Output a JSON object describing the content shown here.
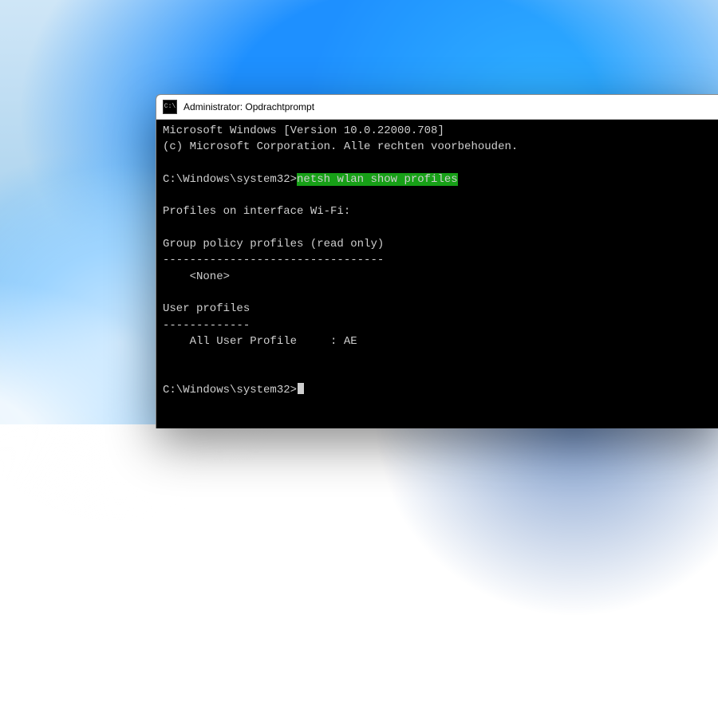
{
  "window": {
    "title": "Administrator: Opdrachtprompt"
  },
  "terminal": {
    "header1": "Microsoft Windows [Version 10.0.22000.708]",
    "header2": "(c) Microsoft Corporation. Alle rechten voorbehouden.",
    "prompt1_path": "C:\\Windows\\system32>",
    "prompt1_cmd": "netsh wlan show profiles",
    "out_iface": "Profiles on interface Wi-Fi:",
    "out_gp_header": "Group policy profiles (read only)",
    "out_gp_rule": "---------------------------------",
    "out_gp_none": "    <None>",
    "out_up_header": "User profiles",
    "out_up_rule": "-------------",
    "out_up_item": "    All User Profile     : AE",
    "prompt2_path": "C:\\Windows\\system32>"
  }
}
